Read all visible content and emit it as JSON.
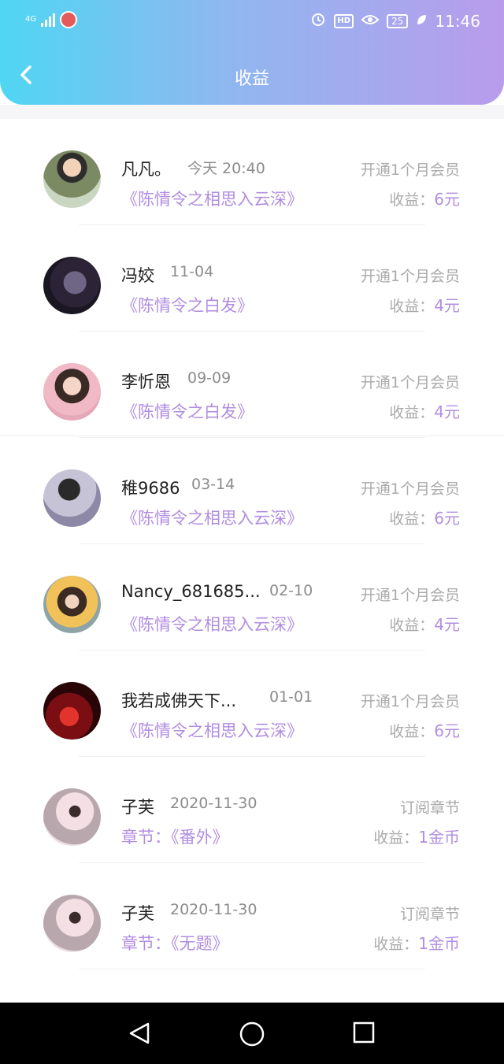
{
  "status": {
    "network": "4G",
    "time": "11:46",
    "battery": "25",
    "hd": "HD"
  },
  "header": {
    "title": "收益"
  },
  "colors": {
    "accent": "#b18ee0",
    "header_start": "#4fd6f2",
    "header_end": "#b99cec"
  },
  "items": [
    {
      "name": "凡凡。",
      "date": "今天 20:40",
      "book": "《陈情令之相思入云深》",
      "type": "开通1个月会员",
      "earn_label": "收益：",
      "earn_value": "6元"
    },
    {
      "name": "冯姣",
      "date": "11-04",
      "book": "《陈情令之白发》",
      "type": "开通1个月会员",
      "earn_label": "收益：",
      "earn_value": "4元"
    },
    {
      "name": "李忻恩",
      "date": "09-09",
      "book": "《陈情令之白发》",
      "type": "开通1个月会员",
      "earn_label": "收益：",
      "earn_value": "4元"
    },
    {
      "name": "稚9686",
      "date": "03-14",
      "book": "《陈情令之相思入云深》",
      "type": "开通1个月会员",
      "earn_label": "收益：",
      "earn_value": "6元"
    },
    {
      "name": "Nancy_681685...",
      "date": "02-10",
      "book": "《陈情令之相思入云深》",
      "type": "开通1个月会员",
      "earn_label": "收益：",
      "earn_value": "4元"
    },
    {
      "name": "我若成佛天下...",
      "date": "01-01",
      "book": "《陈情令之相思入云深》",
      "type": "开通1个月会员",
      "earn_label": "收益：",
      "earn_value": "6元"
    },
    {
      "name": "子芙",
      "date": "2020-11-30",
      "book": "章节：《番外》",
      "type": "订阅章节",
      "earn_label": "收益：",
      "earn_value": "1金币"
    },
    {
      "name": "子芙",
      "date": "2020-11-30",
      "book": "章节：《无题》",
      "type": "订阅章节",
      "earn_label": "收益：",
      "earn_value": "1金币"
    }
  ]
}
